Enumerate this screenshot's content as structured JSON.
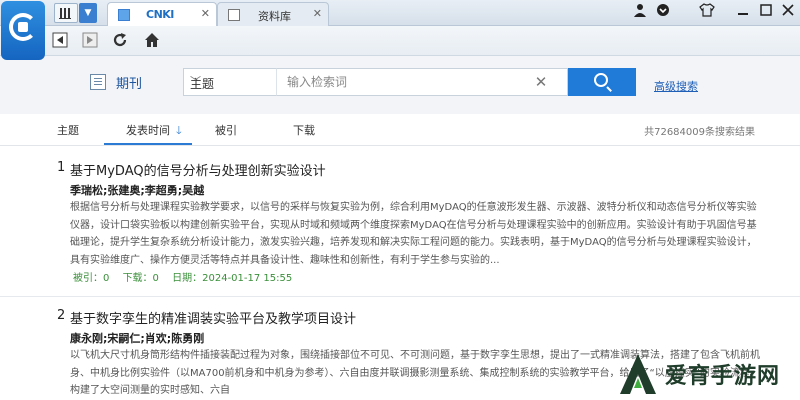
{
  "titlebar": {
    "tabs": [
      {
        "label": "CNKI",
        "active": true
      },
      {
        "label": "资料库",
        "active": false
      }
    ],
    "window_icons": [
      "user-icon",
      "chevron-down-icon",
      "shirt-icon",
      "minimize-icon",
      "maximize-icon",
      "close-icon"
    ]
  },
  "nav": {
    "buttons": [
      "back-icon",
      "forward-icon",
      "refresh-icon",
      "home-icon"
    ]
  },
  "search": {
    "database_label": "期刊",
    "field": "主题",
    "placeholder": "输入检索词",
    "advanced_link": "高级搜索",
    "accent_color": "#1f7ad8"
  },
  "sort": {
    "items": [
      "主题",
      "发表时间",
      "被引",
      "下载"
    ],
    "active": "发表时间",
    "result_count": "共72684009条搜索结果"
  },
  "results": [
    {
      "index": "1",
      "title": "基于MyDAQ的信号分析与处理创新实验设计",
      "authors": "季瑞松;张建奥;李超勇;吴越",
      "abstract": "根据信号分析与处理课程实验教学要求，以信号的采样与恢复实验为例，综合利用MyDAQ的任意波形发生器、示波器、波特分析仪和动态信号分析仪等实验仪器，设计口袋实验板以构建创新实验平台，实现从时域和频域两个维度探索MyDAQ在信号分析与处理课程实验中的创新应用。实验设计有助于巩固信号基础理论，提升学生复杂系统分析设计能力，激发实验兴趣，培养发现和解决实际工程问题的能力。实践表明，基于MyDAQ的信号分析与处理课程实验设计，具有实验维度广、操作方便灵活等特点并具备设计性、趣味性和创新性，有利于学生参与实验的...",
      "cited": "被引：0",
      "downloads": "下载：0",
      "date": "日期：2024-01-17 15:55"
    },
    {
      "index": "2",
      "title": "基于数字孪生的精准调装实验平台及教学项目设计",
      "authors": "康永刚;宋嗣仁;肖欢;陈勇刚",
      "abstract": "以飞机大尺寸机身筒形结构件插接装配过程为对象，围绕插接部位不可见、不可测问题，基于数字孪生思想，提出了一式精准调装算法，搭建了包含飞机前机身、中机身比例实验件（以MA700前机身和中机身为参考）、六自由度并联调摄影测量系统、集成控制系统的实验教学平台，给出了“以虚控实”的实验流程。构建了大空间测量的实时感知、六自"
    }
  ],
  "watermark": {
    "text": "爱育手游网"
  }
}
